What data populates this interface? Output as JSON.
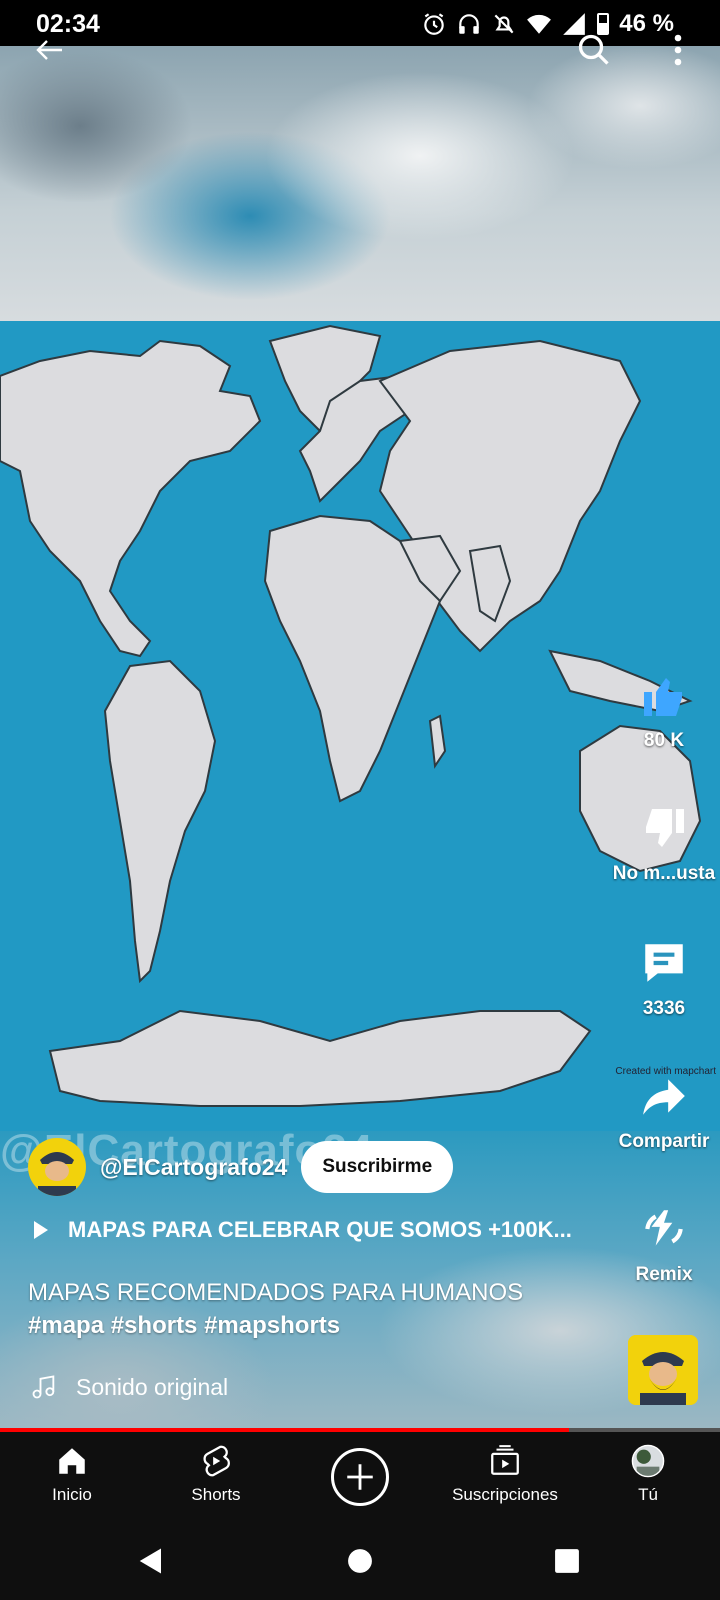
{
  "status_bar": {
    "time": "02:34",
    "battery": "46 %",
    "icons": [
      "alarm-icon",
      "headphones-icon",
      "bell-off-icon",
      "wifi-icon",
      "signal-icon",
      "battery-icon"
    ]
  },
  "video": {
    "watermark": "@ElCartografo24",
    "credit": "Created with mapchart"
  },
  "top_bar": {
    "icons": [
      "back-arrow-icon",
      "search-icon",
      "more-vert-icon"
    ]
  },
  "actions": {
    "like_count": "80 K",
    "dislike_label": "No m...usta",
    "comment_count": "3336",
    "share_label": "Compartir",
    "remix_label": "Remix",
    "like_color": "#3ea6ff"
  },
  "channel": {
    "handle": "@ElCartografo24",
    "subscribe_label": "Suscribirme"
  },
  "playlist": {
    "title": "MAPAS PARA CELEBRAR QUE SOMOS +100K..."
  },
  "description": {
    "text": "MAPAS RECOMENDADOS PARA HUMANOS",
    "tags": "#mapa #shorts #mapshorts"
  },
  "sound": {
    "label": "Sonido original"
  },
  "progress": {
    "fraction": 0.79,
    "color": "#ff0000"
  },
  "nav": {
    "items": [
      {
        "label": "Inicio",
        "icon": "home-icon"
      },
      {
        "label": "Shorts",
        "icon": "shorts-icon"
      },
      {
        "label": "",
        "icon": "create-plus-icon"
      },
      {
        "label": "Suscripciones",
        "icon": "subscriptions-icon"
      },
      {
        "label": "Tú",
        "icon": "profile-avatar"
      }
    ]
  },
  "system_nav": {
    "icons": [
      "system-back-icon",
      "system-home-icon",
      "system-recents-icon"
    ]
  }
}
